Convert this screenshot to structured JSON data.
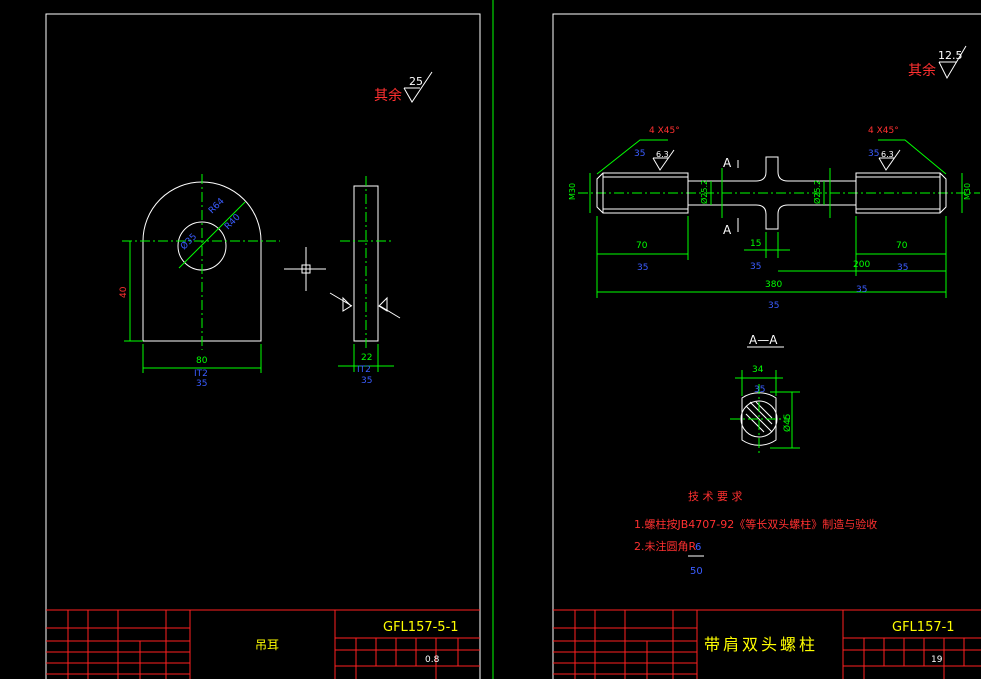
{
  "sheet_left": {
    "roughness_note": "其余",
    "roughness_value": "25",
    "dim_r64": "R64",
    "dim_r40": "R40",
    "dim_phi35": "Ø35",
    "dim_40": "40",
    "dim_80": "80",
    "dim_80_tol": "IT2",
    "dim_80_dev": "35",
    "dim_22": "22",
    "dim_22_tol": "IT2",
    "dim_22_dev": "35",
    "part_name": "吊耳",
    "drawing_no": "GFL157-5-1",
    "weight": "0.8"
  },
  "sheet_right": {
    "roughness_note": "其余",
    "roughness_value": "12.5",
    "chamfer_left": "4 X45°",
    "chamfer_left_tol": "35",
    "chamfer_right": "4 X45°",
    "chamfer_right_tol": "35",
    "rough_63": "6.3",
    "thread_m30": "M30",
    "dia_252": "Ø25.2",
    "section_mark": "A",
    "dim_70": "70",
    "dim_70_tol": "35",
    "dim_15": "15",
    "dim_15_tol": "35",
    "dim_200": "200",
    "dim_200_tol": "35",
    "dim_380": "380",
    "dim_380_tol": "35",
    "section_title": "A—A",
    "dim_34": "34",
    "dim_34_tol": "35",
    "dim_phi45": "Ø45",
    "tech_title": "技 术 要 求",
    "tech_1": "1.螺柱按JB4707-92《等长双头螺柱》制造与验收",
    "tech_2": "2.未注圆角R",
    "tech_2_value": "6",
    "tech_2_tol": "50",
    "part_name": "带肩双头螺柱",
    "drawing_no": "GFL157-1",
    "weight": "19"
  }
}
